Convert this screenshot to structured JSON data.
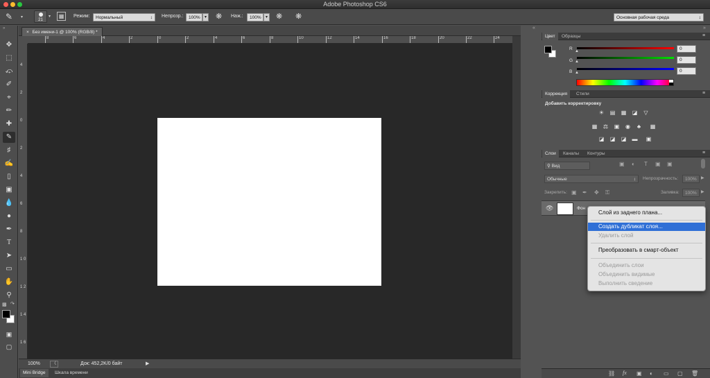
{
  "window": {
    "title": "Adobe Photoshop CS6"
  },
  "options_bar": {
    "brush_size": "21",
    "mode_label": "Режим:",
    "mode_value": "Нормальный",
    "opacity_label": "Непрозр.:",
    "opacity_value": "100%",
    "pressure_label": "Наж.:",
    "pressure_value": "100%",
    "workspace": "Основная рабочая среда"
  },
  "document": {
    "tab_label": "Без имени-1 @ 100% (RGB/8) *",
    "h_ruler": [
      "8",
      "6",
      "4",
      "2",
      "0",
      "2",
      "4",
      "6",
      "8",
      "10",
      "12",
      "14",
      "16",
      "18",
      "20",
      "22",
      "24"
    ],
    "v_ruler": [
      "4",
      "2",
      "0",
      "2",
      "4",
      "6",
      "8",
      "1 0",
      "1 2",
      "1 4",
      "1 6"
    ]
  },
  "status": {
    "zoom": "100%",
    "doc_info": "Док: 452,2K/0 байт"
  },
  "bottom_tabs": [
    "Mini Bridge",
    "Шкала времени"
  ],
  "color_panel": {
    "tabs": [
      "Цвет",
      "Образцы"
    ],
    "channels": [
      {
        "name": "R",
        "value": "0",
        "color": "#ff0000"
      },
      {
        "name": "G",
        "value": "0",
        "color": "#00cc00"
      },
      {
        "name": "B",
        "value": "0",
        "color": "#0000ff"
      }
    ]
  },
  "adjustments_panel": {
    "tabs": [
      "Коррекция",
      "Стили"
    ],
    "title": "Добавить корректировку"
  },
  "layers_panel": {
    "tabs": [
      "Слои",
      "Каналы",
      "Контуры"
    ],
    "filter": "Вид",
    "blend_mode": "Обычные",
    "opacity_label": "Непрозрачность:",
    "opacity_value": "100%",
    "lock_label": "Закрепить:",
    "fill_label": "Заливка:",
    "fill_value": "100%",
    "layer_name": "Фон"
  },
  "context_menu": {
    "items": [
      {
        "label": "Слой из заднего плана...",
        "state": "enabled"
      },
      {
        "label": "Создать дубликат слоя...",
        "state": "highlighted"
      },
      {
        "label": "Удалить слой",
        "state": "disabled"
      },
      {
        "label": "Преобразовать в смарт-объект",
        "state": "enabled"
      },
      {
        "label": "Объединить слои",
        "state": "disabled"
      },
      {
        "label": "Объединить видимые",
        "state": "disabled"
      },
      {
        "label": "Выполнить сведение",
        "state": "disabled"
      }
    ]
  },
  "colors": {
    "highlight": "#2f6fd6",
    "canvas_bg": "#282828",
    "paper": "#ffffff"
  }
}
